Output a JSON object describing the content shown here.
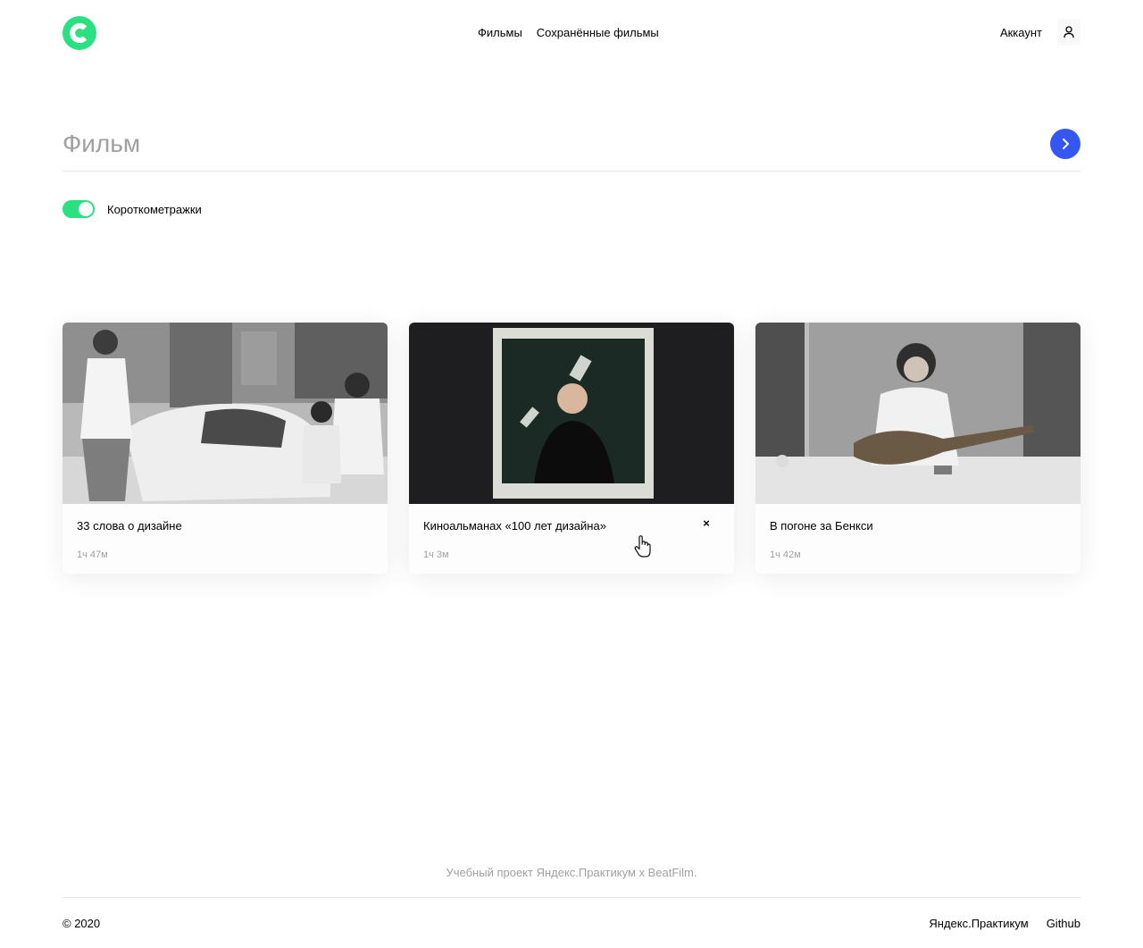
{
  "header": {
    "logo_icon": "logo-c-icon",
    "nav": [
      {
        "label": "Фильмы",
        "active": true
      },
      {
        "label": "Сохранённые фильмы",
        "active": false
      }
    ],
    "account_label": "Аккаунт",
    "account_icon": "user-icon"
  },
  "search": {
    "placeholder": "Фильм",
    "value": "",
    "button_icon": "chevron-right-icon"
  },
  "filter": {
    "label": "Короткометражки",
    "enabled": true
  },
  "cards": [
    {
      "title": "33 слова о дизайне",
      "duration": "1ч 47м",
      "image": "street-photographer-with-children-photo"
    },
    {
      "title": "Киноальманах «100 лет дизайна»",
      "duration": "1ч 3м",
      "image": "polaroid-portrait-photo",
      "hover_action": "×"
    },
    {
      "title": "В погоне за Бенкси",
      "duration": "1ч 42м",
      "image": "man-with-guitar-photo"
    }
  ],
  "footer": {
    "caption": "Учебный проект Яндекс.Практикум х BeatFilm.",
    "copyright": "© 2020",
    "links": [
      "Яндекс.Практикум",
      "Github"
    ]
  },
  "colors": {
    "accent_green": "#2be080",
    "accent_blue": "#3456f3",
    "muted_text": "#a0a0a0"
  }
}
